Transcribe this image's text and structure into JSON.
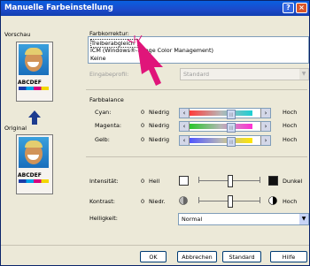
{
  "window": {
    "title": "Manuelle Farbeinstellung",
    "help_label": "?",
    "close_label": "×"
  },
  "vorschau": {
    "label": "Vorschau",
    "original_label": "Original",
    "sample_text": "ABCDEF",
    "up_arrow": "up-arrow-icon"
  },
  "farbkorrektur": {
    "label": "Farbkorrektur:",
    "items": [
      "Treiberabgleich",
      "ICM (Windows®-Image Color Management)",
      "Keine"
    ],
    "selected_index": 0
  },
  "eingabeprofil": {
    "label": "Eingabeprofil:",
    "value": "Standard"
  },
  "farbbalance": {
    "label": "Farbbalance",
    "rows": [
      {
        "name": "Cyan:",
        "value": "0",
        "low": "Niedrig",
        "high": "Hoch"
      },
      {
        "name": "Magenta:",
        "value": "0",
        "low": "Niedrig",
        "high": "Hoch"
      },
      {
        "name": "Gelb:",
        "value": "0",
        "low": "Niedrig",
        "high": "Hoch"
      }
    ]
  },
  "intensitaet": {
    "name": "Intensität:",
    "value": "0",
    "low": "Hell",
    "high": "Dunkel"
  },
  "kontrast": {
    "name": "Kontrast:",
    "value": "0",
    "low": "Niedr.",
    "high": "Hoch"
  },
  "helligkeit": {
    "name": "Helligkeit:",
    "value": "Normal"
  },
  "buttons": {
    "ok": "OK",
    "abbrechen": "Abbrechen",
    "standard": "Standard",
    "hilfe": "Hilfe"
  },
  "colors": {
    "accent": "#0a246a",
    "cursor": "#e0157a"
  }
}
